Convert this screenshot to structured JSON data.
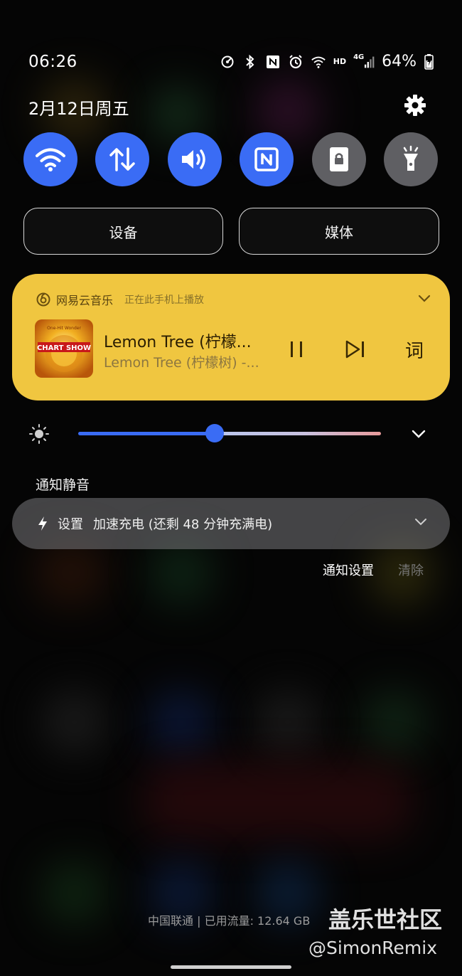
{
  "status_bar": {
    "time": "06:26",
    "hd_label": "HD",
    "network": "4G",
    "battery": "64%",
    "icons": [
      "data-saver-icon",
      "bluetooth-icon",
      "nfc-icon",
      "alarm-icon",
      "wifi-icon",
      "signal-icon",
      "battery-charging-icon"
    ]
  },
  "header": {
    "date": "2月12日周五",
    "settings_icon": "gear-icon"
  },
  "quick_tiles": [
    {
      "name": "wifi",
      "icon": "wifi-icon",
      "active": true
    },
    {
      "name": "mobile-data",
      "icon": "data-arrows-icon",
      "active": true
    },
    {
      "name": "sound",
      "icon": "speaker-icon",
      "active": true
    },
    {
      "name": "nfc",
      "icon": "nfc-icon",
      "active": true
    },
    {
      "name": "lock",
      "icon": "lock-icon",
      "active": false
    },
    {
      "name": "flashlight",
      "icon": "flashlight-icon",
      "active": false
    }
  ],
  "output_buttons": {
    "devices": "设备",
    "media": "媒体"
  },
  "media_player": {
    "app_name": "网易云音乐",
    "playing_on": "正在此手机上播放",
    "title": "Lemon Tree (柠檬...",
    "subtitle": "Lemon Tree (柠檬树) -...",
    "album_text": "CHART SHOW",
    "album_top_text": "One-Hit Wonder",
    "lyrics_label": "词",
    "card_color": "#f0c640"
  },
  "brightness": {
    "level": 0.45,
    "icon": "sun-icon"
  },
  "notifications": {
    "section_label": "通知静音",
    "items": [
      {
        "app": "设置",
        "message": "加速充电 (还剩 48 分钟充满电)",
        "icon": "bolt-icon"
      }
    ],
    "settings_label": "通知设置",
    "clear_label": "清除"
  },
  "footer": {
    "carrier_info": "中国联通 | 已用流量: 12.64 GB",
    "watermark_title": "盖乐世社区",
    "watermark_user": "@SimonRemix"
  },
  "colors": {
    "accent": "#3a6cf5",
    "tile_off": "#5f5f63"
  }
}
